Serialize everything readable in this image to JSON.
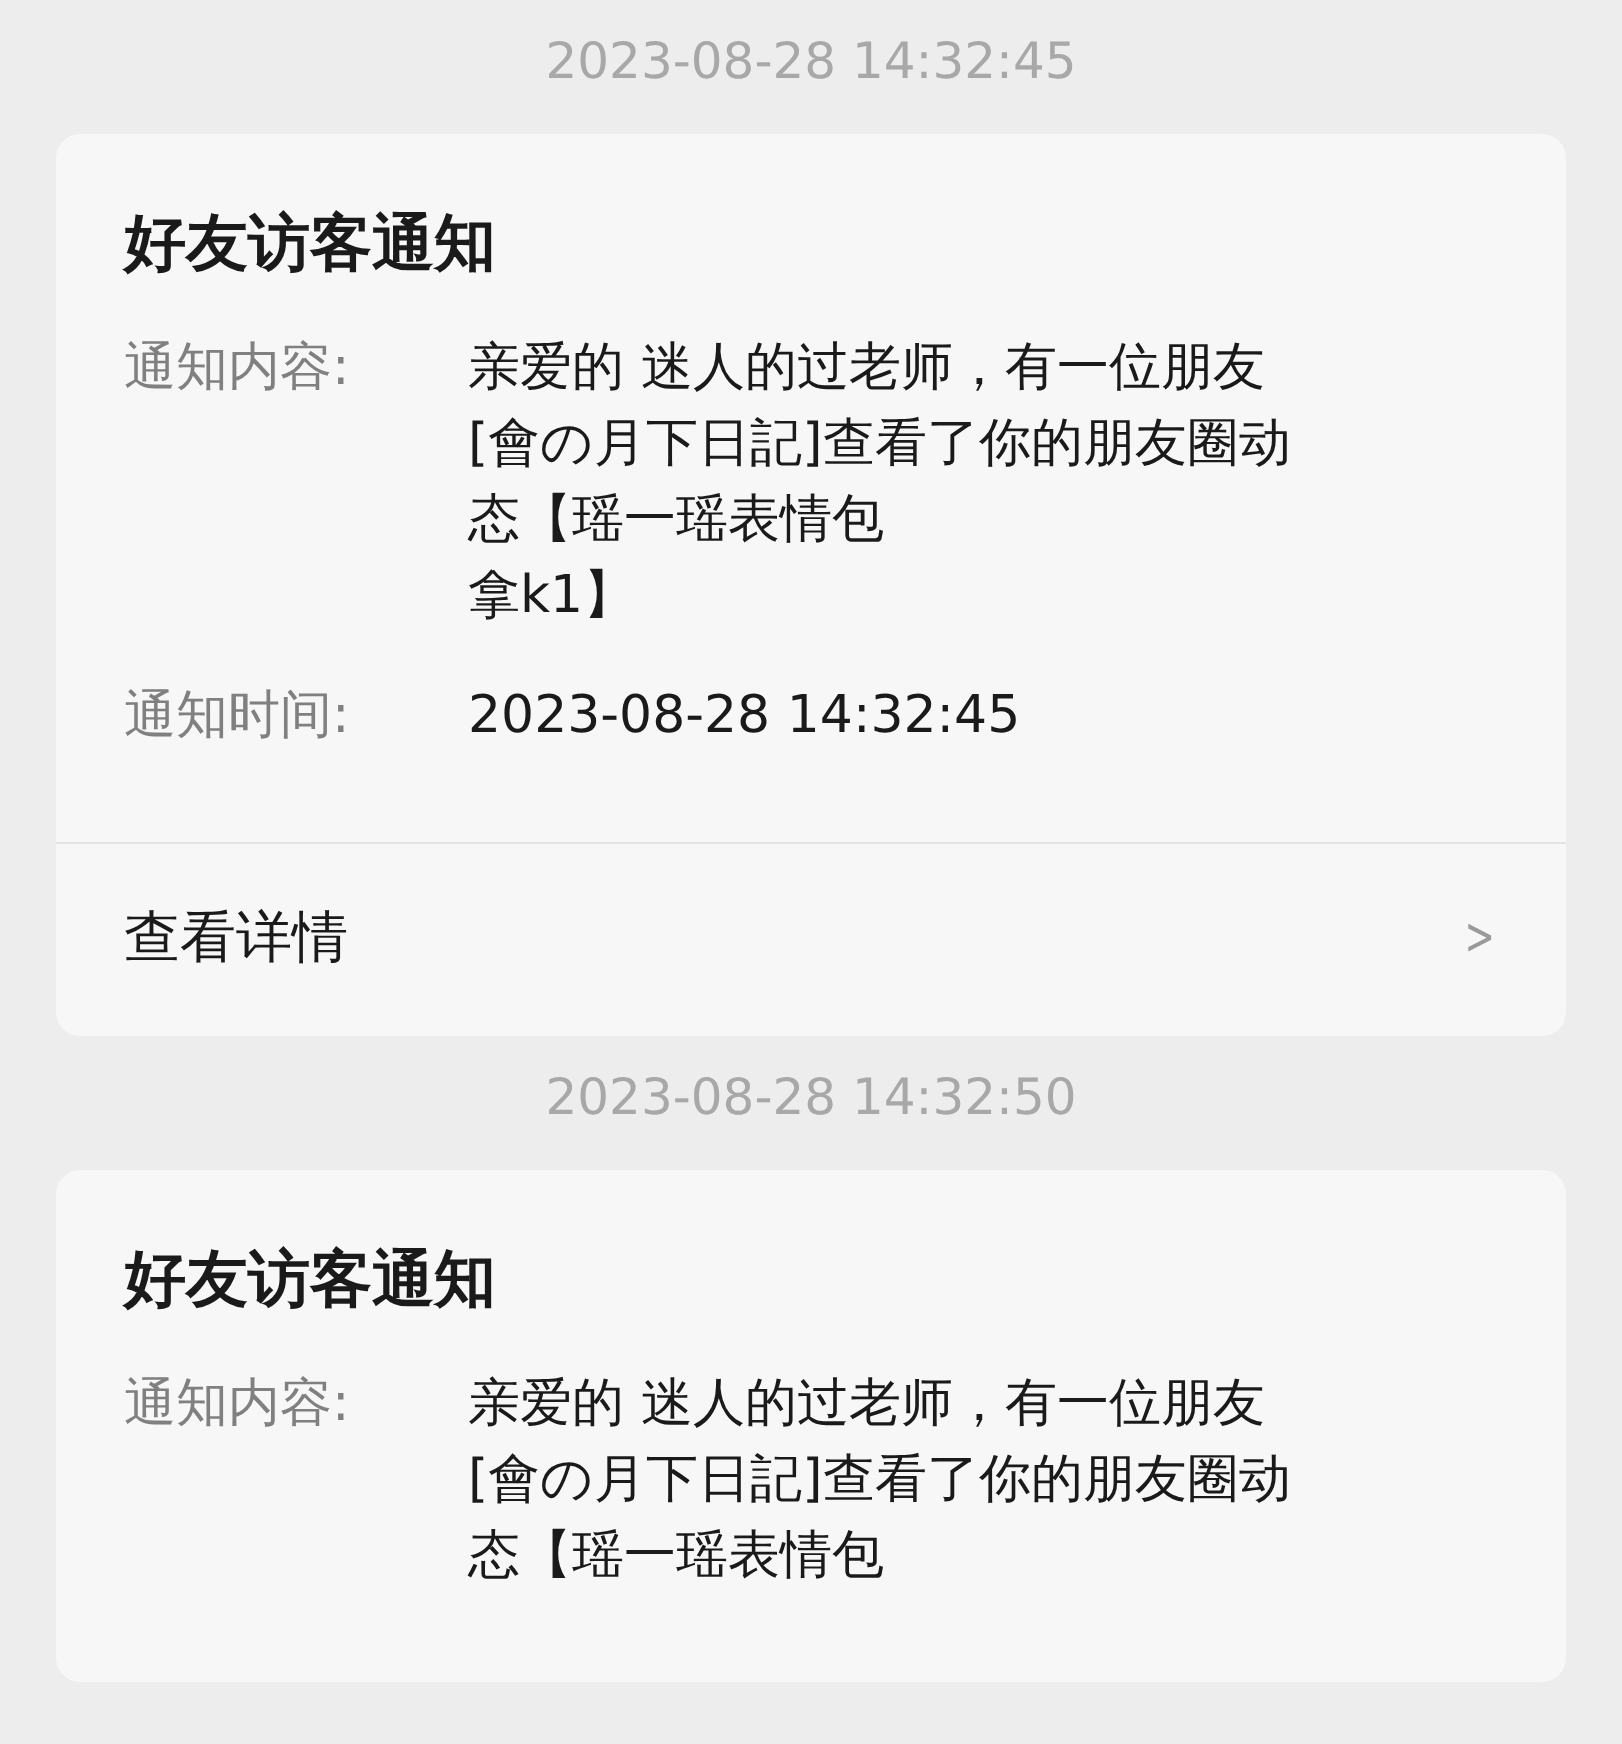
{
  "messages": [
    {
      "timestamp": "2023-08-28 14:32:45",
      "card": {
        "title": "好友访客通知",
        "fields": [
          {
            "label": "通知内容:",
            "lines": [
              "亲爱的 迷人的过老师，有一位朋友",
              "[會の月下日記]查看了你的朋友圈动",
              "态【瑶一瑶表情包",
              "拿k1】"
            ]
          },
          {
            "label": "通知时间:",
            "lines": [
              "2023-08-28 14:32:45"
            ]
          }
        ],
        "link": {
          "label": "查看详情",
          "icon": ">"
        }
      }
    },
    {
      "timestamp": "2023-08-28 14:32:50",
      "card": {
        "title": "好友访客通知",
        "fields": [
          {
            "label": "通知内容:",
            "lines": [
              "亲爱的 迷人的过老师，有一位朋友",
              "[會の月下日記]查看了你的朋友圈动",
              "态【瑶一瑶表情包"
            ]
          }
        ]
      }
    }
  ]
}
